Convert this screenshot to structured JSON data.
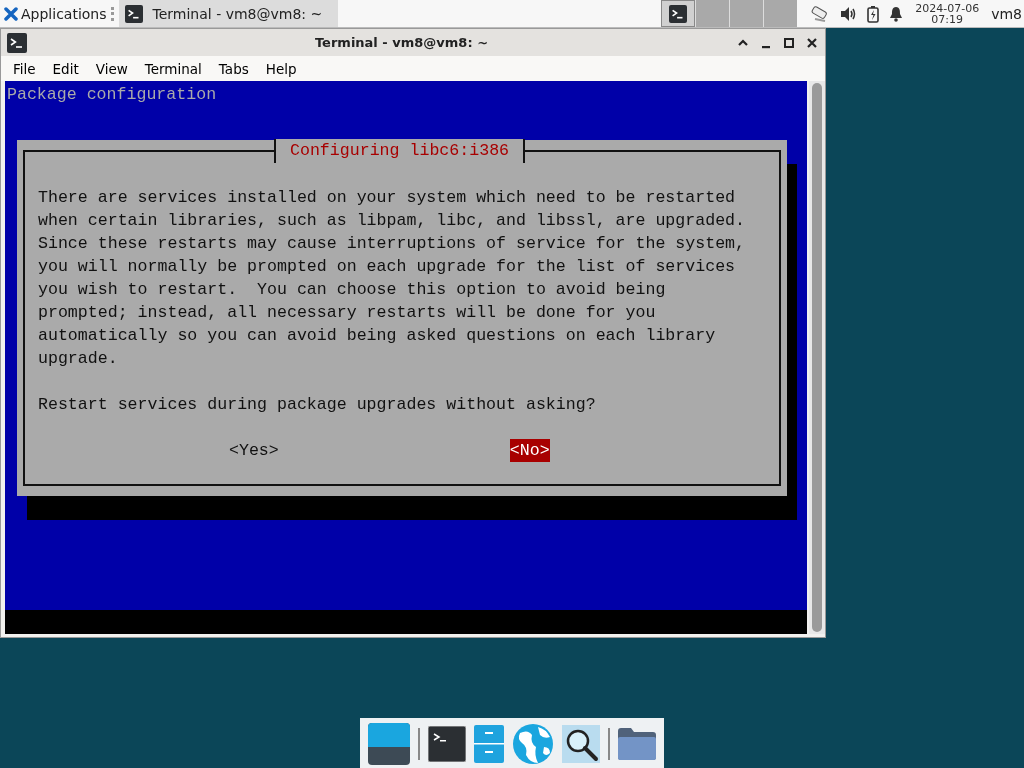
{
  "top_panel": {
    "menu_label": "Applications",
    "taskbar_items": [
      {
        "title": "Terminal - vm8@vm8: ~",
        "selected": true
      }
    ],
    "clock": {
      "date": "2024-07-06",
      "time": "07:19"
    },
    "user": "vm8"
  },
  "window": {
    "title": "Terminal - vm8@vm8: ~",
    "menu": [
      "File",
      "Edit",
      "View",
      "Terminal",
      "Tabs",
      "Help"
    ]
  },
  "terminal": {
    "header": "Package configuration",
    "dialog": {
      "title": "Configuring libc6:i386",
      "lines": [
        "There are services installed on your system which need to be restarted",
        "when certain libraries, such as libpam, libc, and libssl, are upgraded.",
        "Since these restarts may cause interruptions of service for the system,",
        "you will normally be prompted on each upgrade for the list of services",
        "you wish to restart.  You can choose this option to avoid being",
        "prompted; instead, all necessary restarts will be done for you",
        "automatically so you can avoid being asked questions on each library",
        "upgrade."
      ],
      "question": "Restart services during package upgrades without asking?",
      "buttons": [
        {
          "label": "<Yes>",
          "selected": false
        },
        {
          "label": "<No>",
          "selected": true
        }
      ]
    }
  },
  "dock": [
    {
      "kind": "desktop"
    },
    {
      "kind": "terminal"
    },
    {
      "kind": "cabinet"
    },
    {
      "kind": "globe"
    },
    {
      "kind": "search"
    },
    {
      "kind": "folder"
    }
  ]
}
